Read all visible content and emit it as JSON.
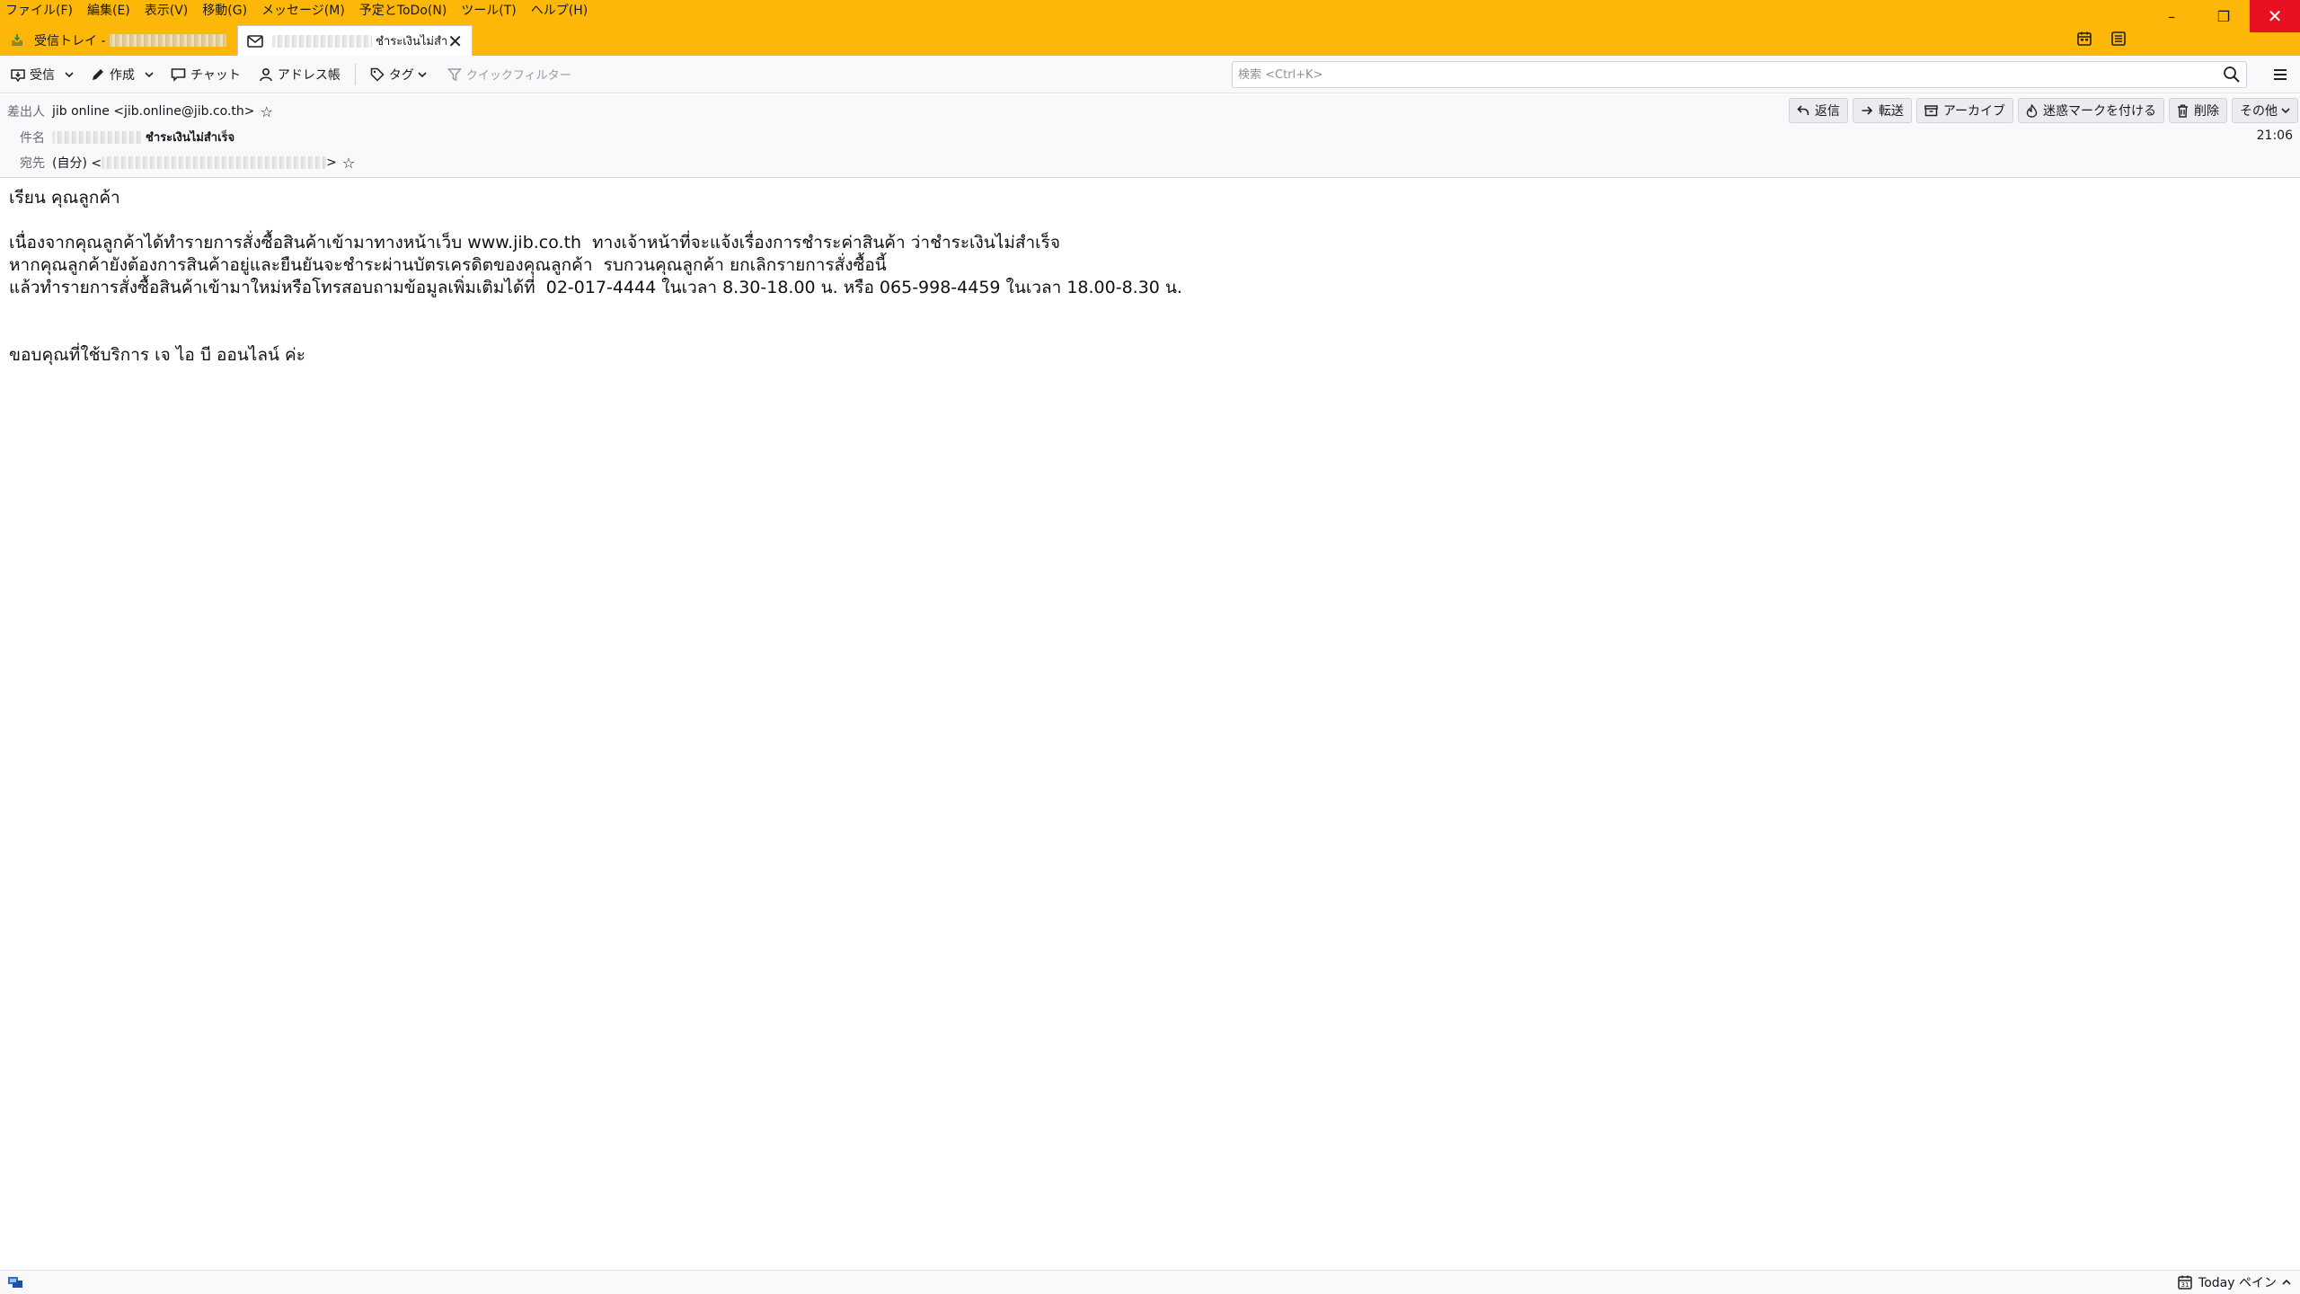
{
  "window": {
    "minimize": "–",
    "restore": "❐",
    "close": "✕"
  },
  "menubar": [
    {
      "label": "ファイル(F)"
    },
    {
      "label": "編集(E)"
    },
    {
      "label": "表示(V)"
    },
    {
      "label": "移動(G)"
    },
    {
      "label": "メッセージ(M)"
    },
    {
      "label": "予定とToDo(N)"
    },
    {
      "label": "ツール(T)"
    },
    {
      "label": "ヘルプ(H)"
    }
  ],
  "tabs": {
    "inbox": {
      "label": "受信トレイ -"
    },
    "message": {
      "label": "ชำระเงินไม่สำ"
    }
  },
  "toolbar": {
    "get_messages": "受信",
    "write": "作成",
    "chat": "チャット",
    "address_book": "アドレス帳",
    "tag": "タグ",
    "quick_filter": "クイックフィルター",
    "search_placeholder": "検索 <Ctrl+K>"
  },
  "header": {
    "from_label": "差出人",
    "from_value": "jib online <jib.online@jib.co.th>",
    "subject_label": "件名",
    "subject_value": "ชำระเงินไม่สำเร็จ",
    "to_label": "宛先",
    "to_prefix": "(自分) <",
    "to_suffix": ">",
    "time": "21:06",
    "actions": {
      "reply": "返信",
      "forward": "転送",
      "archive": "アーカイブ",
      "junk": "迷惑マークを付ける",
      "delete": "削除",
      "other": "その他"
    }
  },
  "body": {
    "greeting": "เรียน คุณลูกค้า",
    "line1": "เนื่องจากคุณลูกค้าได้ทำรายการสั่งซื้อสินค้าเข้ามาทางหน้าเว็บ www.jib.co.th  ทางเจ้าหน้าที่จะแจ้งเรื่องการชำระค่าสินค้า ว่าชำระเงินไม่สำเร็จ",
    "line2": "หากคุณลูกค้ายังต้องการสินค้าอยู่และยืนยันจะชำระผ่านบัตรเครดิตของคุณลูกค้า  รบกวนคุณลูกค้า ยกเลิกรายการสั่งซื้อนี้",
    "line3": "แล้วทำรายการสั่งซื้อสินค้าเข้ามาใหม่หรือโทรสอบถามข้อมูลเพิ่มเติมได้ที่  02-017-4444 ในเวลา 8.30-18.00 น. หรือ 065-998-4459 ในเวลา 18.00-8.30 น.",
    "thanks": "ขอบคุณที่ใช้บริการ เจ ไอ บี ออนไลน์ ค่ะ"
  },
  "statusbar": {
    "today_pane": "Today ペイン"
  }
}
